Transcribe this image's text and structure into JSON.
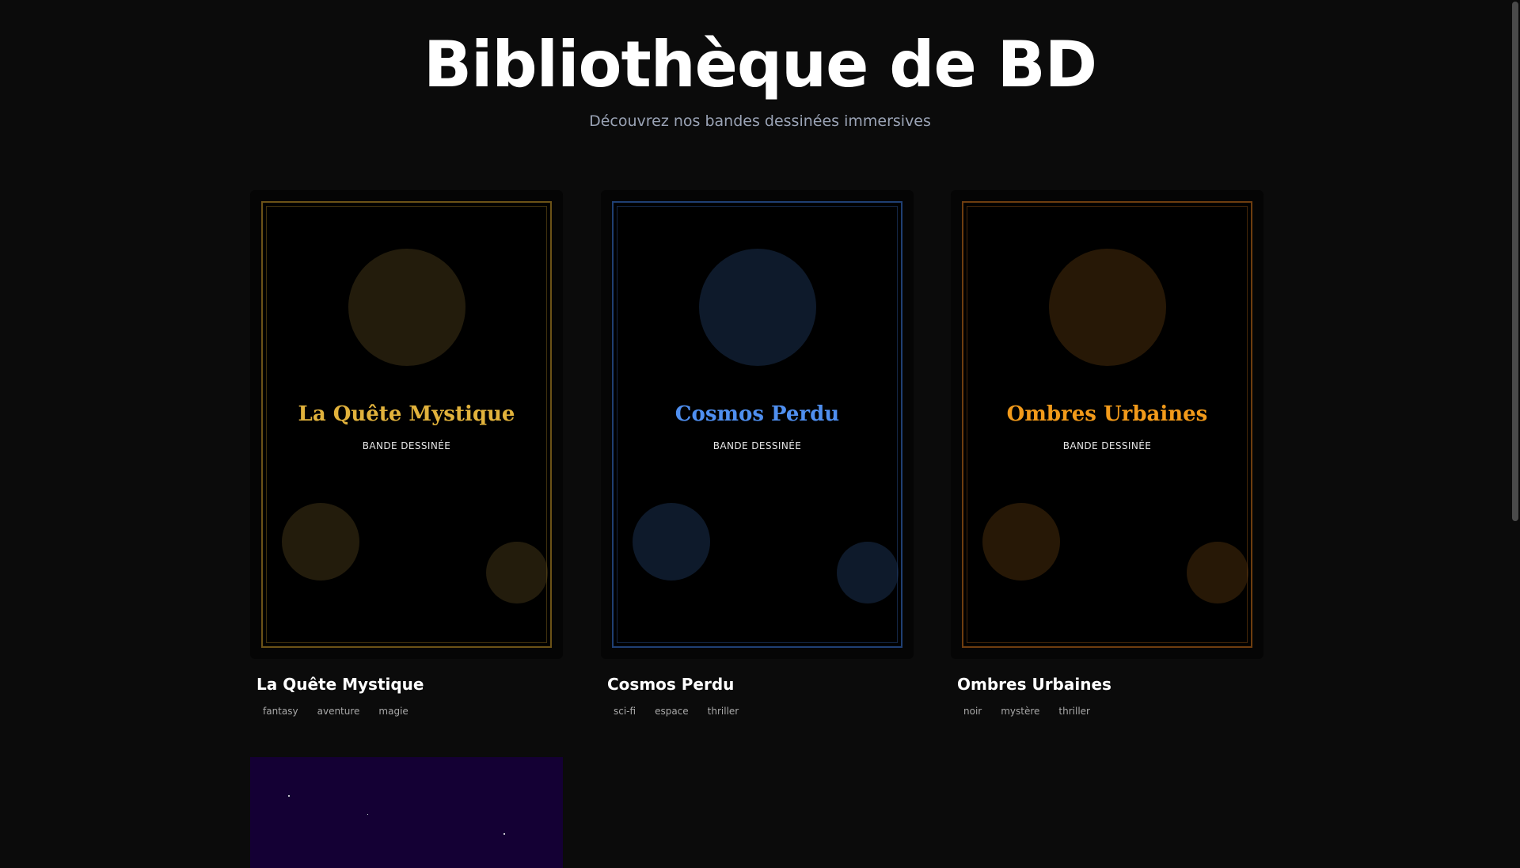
{
  "header": {
    "title": "Bibliothèque de BD",
    "subtitle": "Découvrez nos bandes dessinées immersives"
  },
  "comics": [
    {
      "cover_title": "La Quête Mystique",
      "cover_subtitle": "BANDE DESSINÉE",
      "title": "La Quête Mystique",
      "tags": [
        "fantasy",
        "aventure",
        "magie"
      ],
      "accent": "#e1b23c",
      "border": "#6b5217",
      "circle": "#231c0c"
    },
    {
      "cover_title": "Cosmos Perdu",
      "cover_subtitle": "BANDE DESSINÉE",
      "title": "Cosmos Perdu",
      "tags": [
        "sci-fi",
        "espace",
        "thriller"
      ],
      "accent": "#4f8ff0",
      "border": "#1f3f73",
      "circle": "#0e1a2b"
    },
    {
      "cover_title": "Ombres Urbaines",
      "cover_subtitle": "BANDE DESSINÉE",
      "title": "Ombres Urbaines",
      "tags": [
        "noir",
        "mystère",
        "thriller"
      ],
      "accent": "#f29a1a",
      "border": "#6e3d0f",
      "circle": "#271806"
    }
  ],
  "colors": {
    "page_background": "#0b0b0b",
    "fourth_cover_background": "#140034"
  }
}
